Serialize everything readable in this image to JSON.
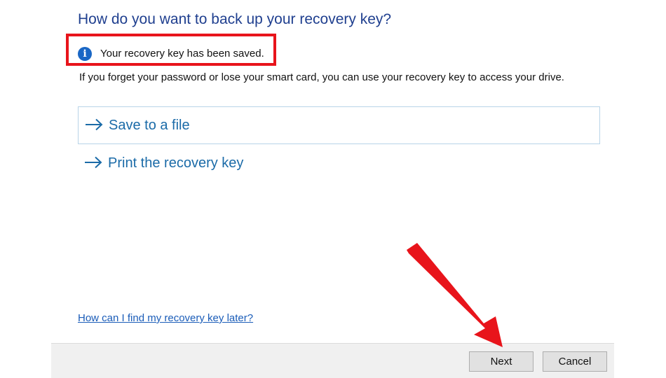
{
  "header": {
    "title": "How do you want to back up your recovery key?"
  },
  "notice": {
    "icon": "info-icon",
    "text": "Your recovery key has been saved."
  },
  "description": "If you forget your password or lose your smart card, you can use your recovery key to access your drive.",
  "options": [
    {
      "label": "Save to a file",
      "icon": "arrow-right-icon",
      "selected": true
    },
    {
      "label": "Print the recovery key",
      "icon": "arrow-right-icon",
      "selected": false
    }
  ],
  "help_link": "How can I find my recovery key later?",
  "buttons": {
    "next": "Next",
    "cancel": "Cancel"
  },
  "colors": {
    "title": "#1f3f8f",
    "option_text": "#1b6ba8",
    "highlight_box": "#e8141b",
    "annotation_arrow": "#e8141b"
  }
}
